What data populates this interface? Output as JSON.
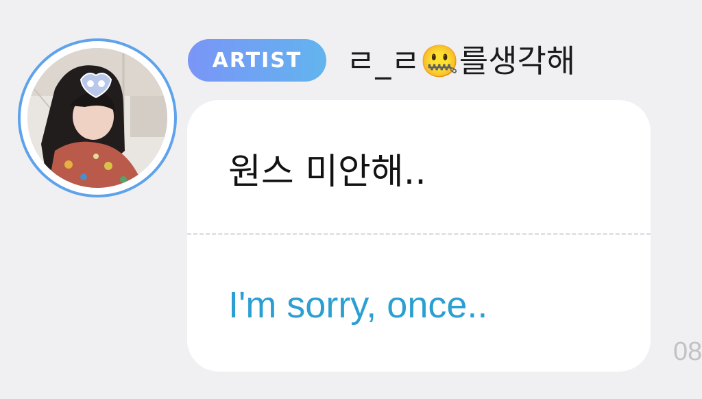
{
  "sender": {
    "badge_label": "ARTIST",
    "username": "ㄹ_ㄹ🤐를생각해"
  },
  "message": {
    "original_text": "원스 미안해..",
    "translated_text": "I'm sorry, once..",
    "timestamp": "08"
  },
  "colors": {
    "background": "#f0f0f3",
    "avatar_ring": "#5ea2ec",
    "badge_gradient_start": "#7a95f7",
    "badge_gradient_end": "#62b4ee",
    "translation_text": "#2c9fd2"
  }
}
